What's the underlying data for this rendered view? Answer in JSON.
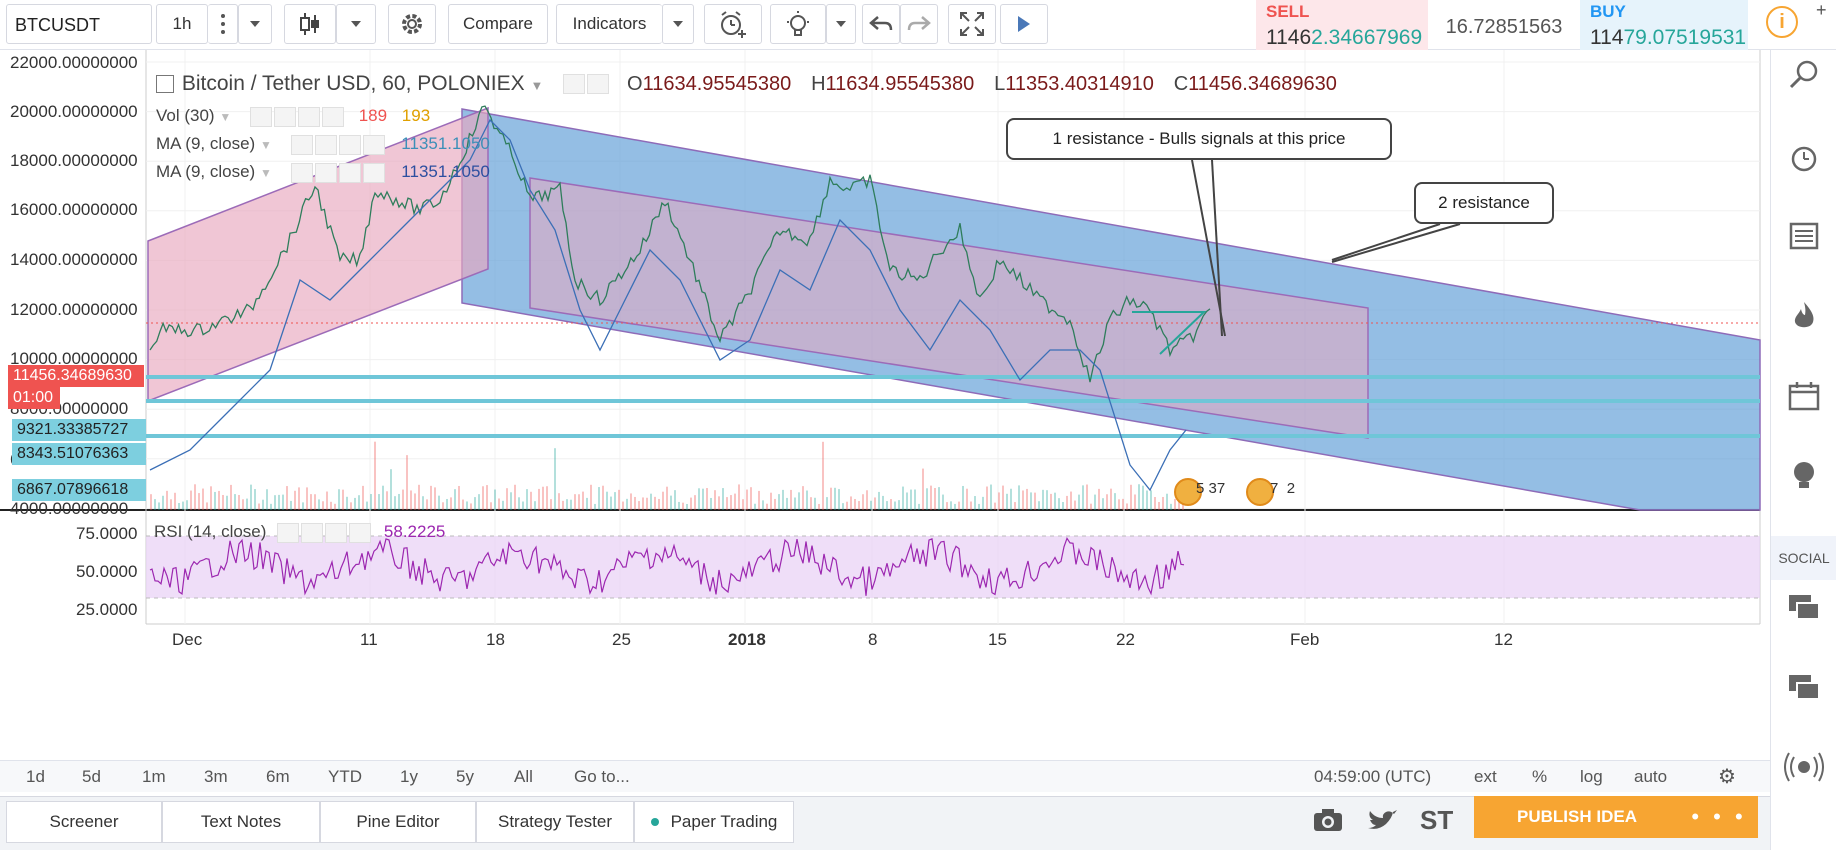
{
  "toolbar": {
    "symbol": "BTCUSDT",
    "interval": "1h",
    "compare_label": "Compare",
    "indicators_label": "Indicators"
  },
  "quote": {
    "sell_label": "SELL",
    "sell_prefix": "1146",
    "sell_suffix": "2.34667969",
    "spread": "16.72851563",
    "buy_label": "BUY",
    "buy_prefix": "114",
    "buy_suffix": "79.07519531"
  },
  "legend": {
    "title": "Bitcoin / Tether USD, 60, POLONIEX",
    "o_label": "O",
    "o_value": "11634.95545380",
    "h_label": "H",
    "h_value": "11634.95545380",
    "l_label": "L",
    "l_value": "11353.40314910",
    "c_label": "C",
    "c_value": "11456.34689630",
    "vol_label": "Vol (30)",
    "vol_v1": "189",
    "vol_v2": "193",
    "ma1_label": "MA (9, close)",
    "ma1_value": "11351.1050",
    "ma2_label": "MA (9, close)",
    "ma2_value": "11351.1050",
    "rsi_label": "RSI (14, close)",
    "rsi_value": "58.2225"
  },
  "price_axis": [
    "22000.00000000",
    "20000.00000000",
    "18000.00000000",
    "16000.00000000",
    "14000.00000000",
    "12000.00000000",
    "10000.00000000",
    "8000.00000000",
    "6000.00000000",
    "4000.00000000"
  ],
  "price_tags": {
    "last_price": "11456.34689630",
    "countdown": "01:00",
    "level1": "9321.33385727",
    "level2": "8343.51076363",
    "level3": "6867.07896618"
  },
  "rsi_axis": [
    "75.0000",
    "50.0000",
    "25.0000"
  ],
  "time_axis": [
    "Dec",
    "11",
    "18",
    "25",
    "2018",
    "8",
    "15",
    "22",
    "Feb",
    "12"
  ],
  "callouts": {
    "c1": "1 resistance - Bulls signals at this price",
    "c2": "2 resistance"
  },
  "events": {
    "e1_a": "5",
    "e1_b": "37",
    "e2_a": "7",
    "e2_b": "2"
  },
  "ranges": [
    "1d",
    "5d",
    "1m",
    "3m",
    "6m",
    "YTD",
    "1y",
    "5y",
    "All",
    "Go to..."
  ],
  "clock": "04:59:00 (UTC)",
  "axis_opts": [
    "ext",
    "%",
    "log",
    "auto"
  ],
  "bottom_tabs": [
    "Screener",
    "Text Notes",
    "Pine Editor",
    "Strategy Tester",
    "Paper Trading"
  ],
  "bottom_icons": {
    "st": "ST"
  },
  "publish_label": "PUBLISH IDEA",
  "publish_more": "• • •",
  "sidebar": {
    "social": "SOCIAL"
  },
  "colors": {
    "up": "#26a69a",
    "down": "#ef5350",
    "channel_blue": "#5b9bd5",
    "channel_pink": "#e8a7bf",
    "rsi": "#9c27b0",
    "ma": "#3b6fb6",
    "level_line": "#6fc6d8",
    "publish": "#f7a532"
  }
}
